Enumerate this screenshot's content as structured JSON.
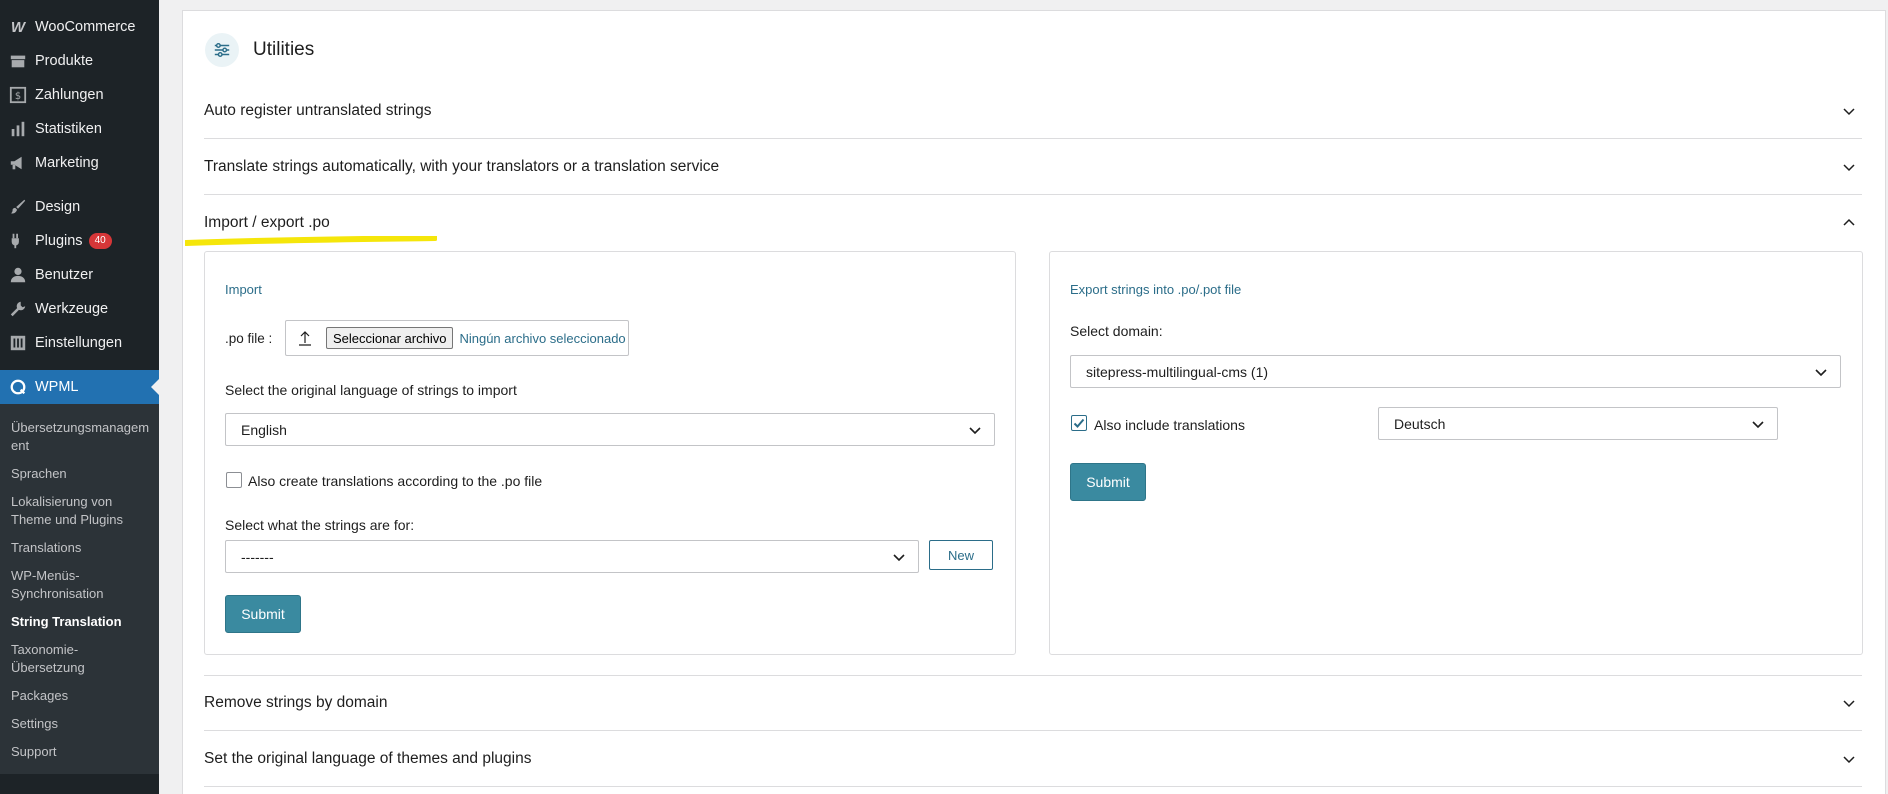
{
  "sidebar": {
    "items": [
      {
        "label": "WooCommerce",
        "icon": "woocommerce-icon"
      },
      {
        "label": "Produkte",
        "icon": "archive-icon"
      },
      {
        "label": "Zahlungen",
        "icon": "dollar-icon"
      },
      {
        "label": "Statistiken",
        "icon": "bar-chart-icon"
      },
      {
        "label": "Marketing",
        "icon": "megaphone-icon"
      },
      {
        "label": "Design",
        "icon": "paintbrush-icon"
      },
      {
        "label": "Plugins",
        "icon": "plugin-icon",
        "badge": "40"
      },
      {
        "label": "Benutzer",
        "icon": "user-icon"
      },
      {
        "label": "Werkzeuge",
        "icon": "wrench-icon"
      },
      {
        "label": "Einstellungen",
        "icon": "settings-icon"
      }
    ],
    "active": {
      "label": "WPML",
      "icon": "wpml-icon"
    },
    "submenu": [
      "Übersetzungsmanagement",
      "Sprachen",
      "Lokalisierung von Theme und Plugins",
      "Translations",
      "WP-Menüs-Synchronisation",
      "String Translation",
      "Taxonomie-Übersetzung",
      "Packages",
      "Settings",
      "Support"
    ],
    "accent": "#2271b1",
    "background": "#1d2327"
  },
  "utilities": {
    "title": "Utilities",
    "sections": [
      "Auto register untranslated strings",
      "Translate strings automatically, with your translators or a translation service",
      "Import / export .po",
      "Remove strings by domain",
      "Set the original language of themes and plugins"
    ]
  },
  "import_panel": {
    "title": "Import",
    "po_file_label": ".po file :",
    "file_button": "Seleccionar archivo",
    "file_status": "Ningún archivo seleccionado",
    "language_label": "Select the original language of strings to import",
    "language_value": "English",
    "create_translations_label": "Also create translations according to the .po file",
    "create_translations_checked": false,
    "strings_for_label": "Select what the strings are for:",
    "strings_for_value": "-------",
    "new_button": "New",
    "submit_button": "Submit"
  },
  "export_panel": {
    "title": "Export strings into .po/.pot file",
    "domain_label": "Select domain:",
    "domain_value": "sitepress-multilingual-cms (1)",
    "include_translations_label": "Also include translations",
    "include_translations_checked": true,
    "translation_language": "Deutsch",
    "submit_button": "Submit"
  },
  "colors": {
    "submit": "#3a8aa0",
    "link": "#2b6d89",
    "highlight": "#f5e60a"
  }
}
